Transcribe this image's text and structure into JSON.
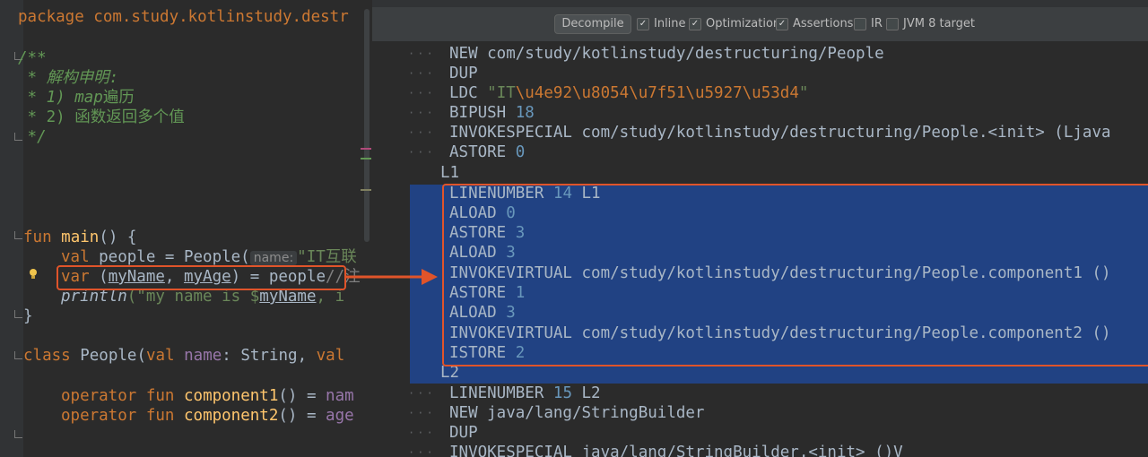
{
  "editor": {
    "lines": {
      "package": "package com.study.kotlinstudy.destr",
      "doc_open": "/**",
      "doc_1": " * 解构申明:",
      "doc_2_prefix": " * 1) ",
      "doc_2_map": "map",
      "doc_2_suffix": "遍历",
      "doc_3": " * 2) 函数返回多个值",
      "doc_close": " */",
      "main_kw": "fun",
      "main_name": "main",
      "main_rest": "() {",
      "val_kw": "val",
      "people_decl": " people = People(",
      "param_hint": "name:",
      "param_value": "\"IT互联",
      "var_kw": "var",
      "destructure_open": " (",
      "my_name": "myName",
      "comma": ", ",
      "my_age": "myAge",
      "destructure_rest": ") = people",
      "trailing_comment": "//注",
      "println_fn": "println",
      "println_arg_start": "(\"my name is $",
      "println_var": "myName",
      "println_arg_end": ", i",
      "close_brace": "}",
      "class_kw": "class",
      "class_name": " People(",
      "class_val": "val",
      "class_prop": " name",
      "class_rest": ": String, ",
      "class_val2": "val",
      "op_kw": "operator",
      "fun_kw": "fun",
      "comp1": "component1",
      "comp1_rest": "() = ",
      "comp1_prop": "nam",
      "comp2": "component2",
      "comp2_rest": "() = ",
      "comp2_prop": "age"
    }
  },
  "toolbar": {
    "decompile_label": "Decompile",
    "options": [
      {
        "label": "Inline",
        "checked": true
      },
      {
        "label": "Optimization",
        "checked": true
      },
      {
        "label": "Assertions",
        "checked": true
      },
      {
        "label": "IR",
        "checked": false
      },
      {
        "label": "JVM 8 target",
        "checked": false
      }
    ]
  },
  "bytecode": {
    "l1": "NEW com/study/kotlinstudy/destructuring/People",
    "l2": "DUP",
    "l3_op": "LDC ",
    "l3_q1": "\"IT",
    "l3_e1": "\\u4e92",
    "l3_e2": "\\u8054",
    "l3_e3": "\\u7f51",
    "l3_e4": "\\u5927",
    "l3_e5": "\\u53d4",
    "l3_q2": "\"",
    "l4_op": "BIPUSH ",
    "l4_num": "18",
    "l5": "INVOKESPECIAL com/study/kotlinstudy/destructuring/People.<init> (Ljava",
    "l6_op": "ASTORE ",
    "l6_num": "0",
    "label_l1": "L1",
    "l7_op": "LINENUMBER ",
    "l7_num": "14",
    "l7_rest": " L1",
    "l8_op": "ALOAD ",
    "l8_num": "0",
    "l9_op": "ASTORE ",
    "l9_num": "3",
    "l10_op": "ALOAD ",
    "l10_num": "3",
    "l11": "INVOKEVIRTUAL com/study/kotlinstudy/destructuring/People.component1 ()",
    "l12_op": "ASTORE ",
    "l12_num": "1",
    "l13_op": "ALOAD ",
    "l13_num": "3",
    "l14": "INVOKEVIRTUAL com/study/kotlinstudy/destructuring/People.component2 ()",
    "l15_op": "ISTORE ",
    "l15_num": "2",
    "label_l2": "L2",
    "l16_op": "LINENUMBER ",
    "l16_num": "15",
    "l16_rest": " L2",
    "l17": "NEW java/lang/StringBuilder",
    "l18": "DUP",
    "l19": "INVOKESPECIAL java/lang/StringBuilder.<init> ()V"
  },
  "colors": {
    "annotation": "#e0542a",
    "selection": "#214283"
  }
}
